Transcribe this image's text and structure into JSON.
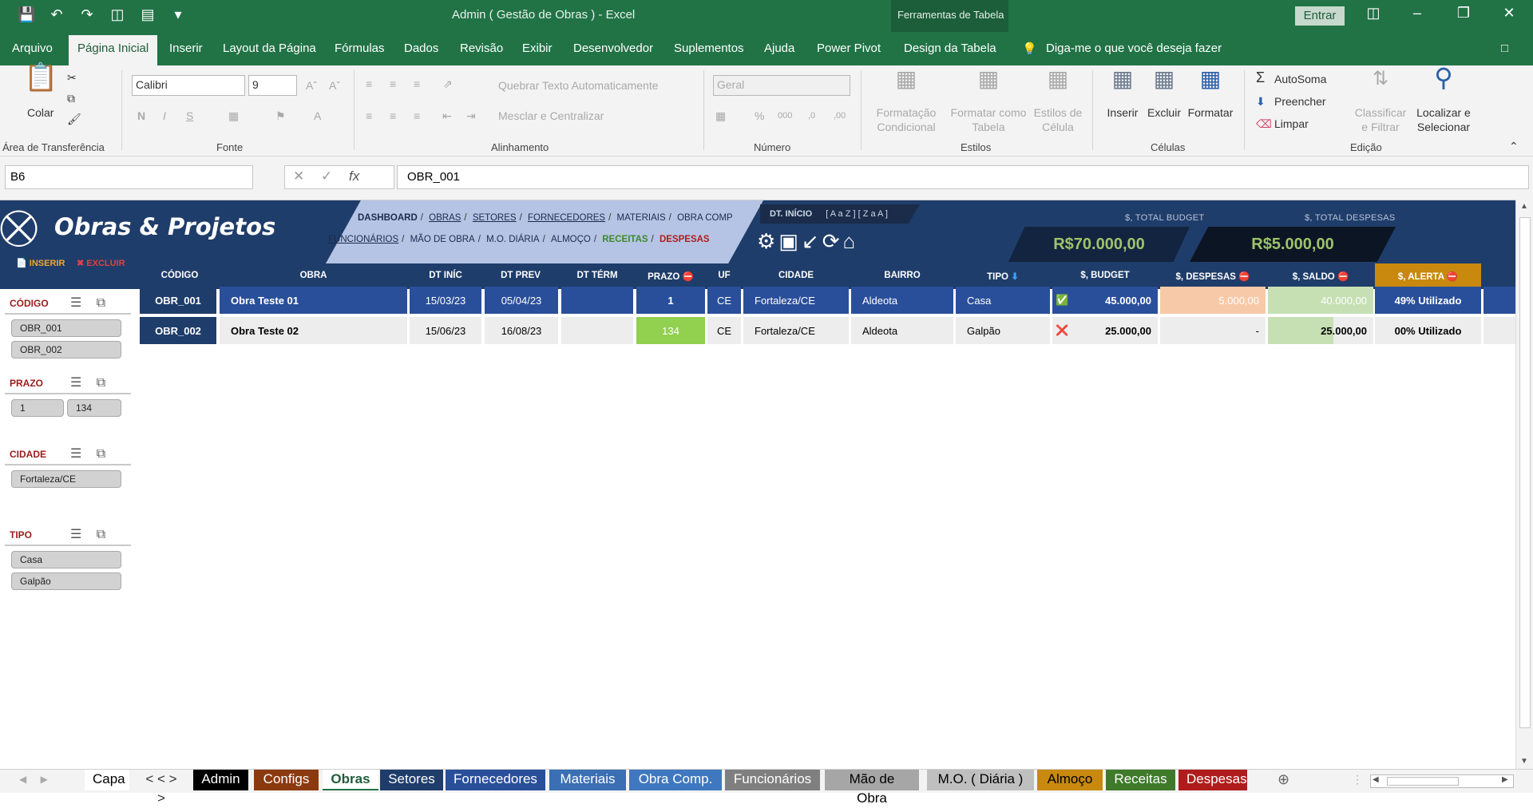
{
  "window": {
    "title": "Admin ( Gestão de Obras ) - Excel",
    "table_tools": "Ferramentas de Tabela",
    "signin": "Entrar"
  },
  "menu": {
    "items": [
      "Arquivo",
      "Página Inicial",
      "Inserir",
      "Layout da Página",
      "Fórmulas",
      "Dados",
      "Revisão",
      "Exibir",
      "Desenvolvedor",
      "Suplementos",
      "Ajuda",
      "Power Pivot",
      "Design da Tabela"
    ],
    "active": "Página Inicial",
    "tell_me": "Diga-me o que você deseja fazer"
  },
  "ribbon": {
    "clipboard": {
      "paste": "Colar",
      "group": "Área de Transferência"
    },
    "font": {
      "name": "Calibri",
      "size": "9",
      "group": "Fonte"
    },
    "alignment": {
      "wrap": "Quebrar Texto Automaticamente",
      "merge": "Mesclar e Centralizar",
      "group": "Alinhamento"
    },
    "number": {
      "format": "Geral",
      "group": "Número"
    },
    "styles": {
      "conditional_1": "Formatação",
      "conditional_2": "Condicional",
      "format_table_1": "Formatar como",
      "format_table_2": "Tabela",
      "cell_styles_1": "Estilos de",
      "cell_styles_2": "Célula",
      "group": "Estilos"
    },
    "cells": {
      "insert": "Inserir",
      "delete": "Excluir",
      "format": "Formatar",
      "group": "Células"
    },
    "editing": {
      "autosum": "AutoSoma",
      "fill": "Preencher",
      "clear": "Limpar",
      "sort_1": "Classificar",
      "sort_2": "e Filtrar",
      "find_1": "Localizar e",
      "find_2": "Selecionar",
      "group": "Edição"
    }
  },
  "formula_bar": {
    "name_box": "B6",
    "value": "OBR_001"
  },
  "dashboard": {
    "title": "Obras & Projetos",
    "nav_row1": [
      "DASHBOARD",
      "OBRAS",
      "SETORES",
      "FORNECEDORES",
      "MATERIAIS",
      "OBRA COMP"
    ],
    "nav_row2": [
      "FUNCIONÁRIOS",
      "MÃO DE OBRA",
      "M.O. DIÁRIA",
      "ALMOÇO",
      "RECEITAS",
      "DESPESAS"
    ],
    "dt_inicio": "DT. INÍCIO",
    "sort_options": "[ A a Z ] [ Z a A ]",
    "total_budget_label": "$, TOTAL BUDGET",
    "total_budget_value": "R$70.000,00",
    "total_despesas_label": "$, TOTAL DESPESAS",
    "total_despesas_value": "R$5.000,00",
    "inserir": "INSERIR",
    "excluir": "EXCLUIR"
  },
  "table": {
    "columns": [
      "CÓDIGO",
      "OBRA",
      "DT INÍC",
      "DT PREV",
      "DT TÉRM",
      "PRAZO",
      "UF",
      "CIDADE",
      "BAIRRO",
      "TIPO",
      "$, BUDGET",
      "$, DESPESAS",
      "$, SALDO",
      "$, ALERTA"
    ],
    "rows": [
      {
        "codigo": "OBR_001",
        "obra": "Obra Teste 01",
        "dt_inic": "15/03/23",
        "dt_prev": "05/04/23",
        "dt_term": "",
        "prazo": "1",
        "uf": "CE",
        "cidade": "Fortaleza/CE",
        "bairro": "Aldeota",
        "tipo": "Casa",
        "budget": "45.000,00",
        "despesas": "5.000,00",
        "saldo": "40.000,00",
        "alerta": "49% Utilizado"
      },
      {
        "codigo": "OBR_002",
        "obra": "Obra Teste 02",
        "dt_inic": "15/06/23",
        "dt_prev": "16/08/23",
        "dt_term": "",
        "prazo": "134",
        "uf": "CE",
        "cidade": "Fortaleza/CE",
        "bairro": "Aldeota",
        "tipo": "Galpão",
        "budget": "25.000,00",
        "despesas": "-",
        "saldo": "25.000,00",
        "alerta": "00% Utilizado"
      }
    ]
  },
  "filters": {
    "codigo": {
      "title": "CÓDIGO",
      "items": [
        "OBR_001",
        "OBR_002"
      ]
    },
    "prazo": {
      "title": "PRAZO",
      "items": [
        "1",
        "134"
      ]
    },
    "cidade": {
      "title": "CIDADE",
      "items": [
        "Fortaleza/CE"
      ]
    },
    "tipo": {
      "title": "TIPO",
      "items": [
        "Casa",
        "Galpão"
      ]
    }
  },
  "sheet_tabs": {
    "items": [
      {
        "label": "Capa",
        "bg": "#ffffff",
        "fg": "#000000"
      },
      {
        "label": "< < > >",
        "bg": "#f3f3f3",
        "fg": "#333333"
      },
      {
        "label": "Admin",
        "bg": "#000000",
        "fg": "#ffffff"
      },
      {
        "label": "Configs",
        "bg": "#8b3a0f",
        "fg": "#ffffff"
      },
      {
        "label": "Obras",
        "bg": "#ffffff",
        "fg": "#1f5d39"
      },
      {
        "label": "Setores",
        "bg": "#1f3d6a",
        "fg": "#ffffff"
      },
      {
        "label": "Fornecedores",
        "bg": "#2a4f9a",
        "fg": "#ffffff"
      },
      {
        "label": "Materiais",
        "bg": "#3a6fb4",
        "fg": "#ffffff"
      },
      {
        "label": "Obra Comp.",
        "bg": "#3f78c0",
        "fg": "#ffffff"
      },
      {
        "label": "Funcionários",
        "bg": "#7f7f7f",
        "fg": "#ffffff"
      },
      {
        "label": "Mão de Obra",
        "bg": "#a6a6a6",
        "fg": "#000000"
      },
      {
        "label": "M.O. ( Diária )",
        "bg": "#bfbfbf",
        "fg": "#000000"
      },
      {
        "label": "Almoço",
        "bg": "#c8890e",
        "fg": "#000000"
      },
      {
        "label": "Receitas",
        "bg": "#3e7a2a",
        "fg": "#ffffff"
      },
      {
        "label": "Despesas",
        "bg": "#b01c1c",
        "fg": "#ffffff"
      }
    ]
  },
  "colors": {
    "excel_green": "#217346",
    "navy": "#1f3d6a",
    "accent_green": "#9ec36a",
    "alert": "#c8890e"
  }
}
